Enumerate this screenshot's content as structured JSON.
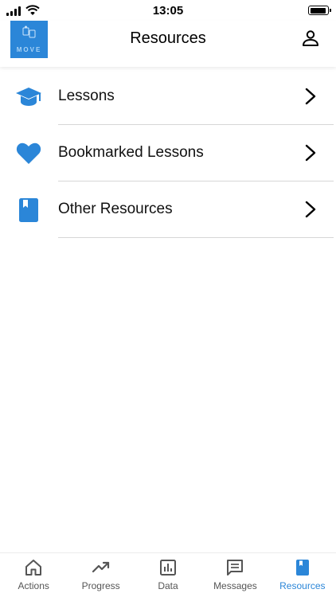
{
  "status_bar": {
    "time": "13:05"
  },
  "header": {
    "title": "Resources",
    "logo_text": "MOVE"
  },
  "list": {
    "items": [
      {
        "label": "Lessons",
        "icon": "graduation-cap-icon"
      },
      {
        "label": "Bookmarked Lessons",
        "icon": "heart-icon"
      },
      {
        "label": "Other Resources",
        "icon": "book-icon"
      }
    ]
  },
  "tab_bar": {
    "tabs": [
      {
        "label": "Actions",
        "icon": "home-icon",
        "active": false
      },
      {
        "label": "Progress",
        "icon": "trending-up-icon",
        "active": false
      },
      {
        "label": "Data",
        "icon": "bar-chart-icon",
        "active": false
      },
      {
        "label": "Messages",
        "icon": "message-icon",
        "active": false
      },
      {
        "label": "Resources",
        "icon": "book-icon",
        "active": true
      }
    ]
  },
  "colors": {
    "accent": "#2b86d8",
    "divider": "#d6d6d6",
    "inactive": "#555555"
  }
}
